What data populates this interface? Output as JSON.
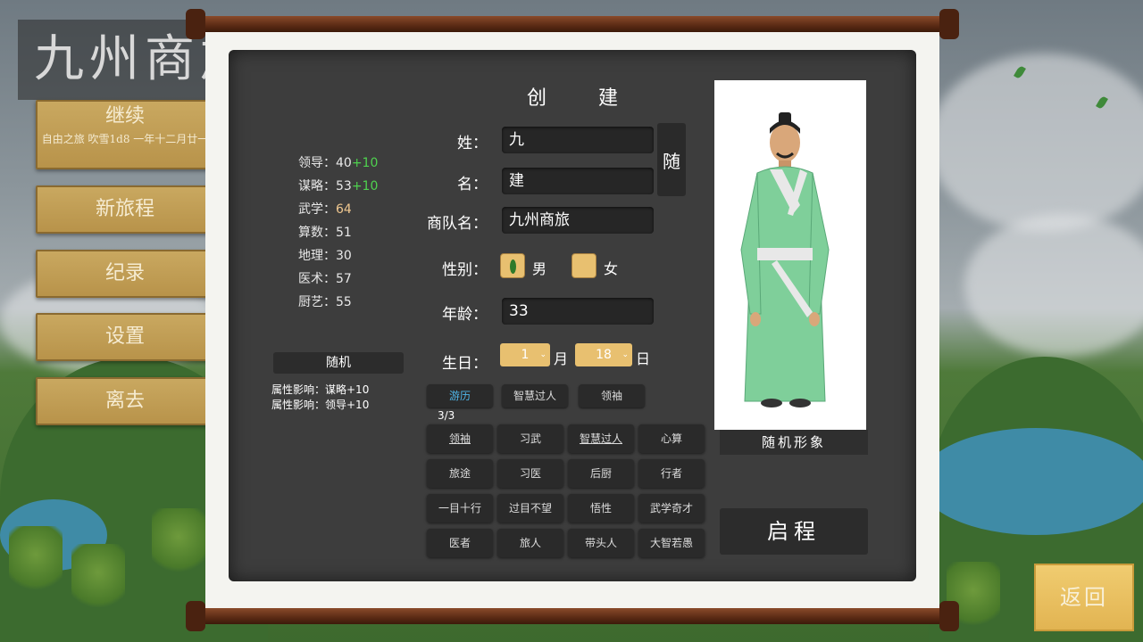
{
  "game_title": "九州商旅",
  "menu": {
    "continue": {
      "label": "继续",
      "save_info": "自由之旅 吹雪1d8 一年十二月廿一"
    },
    "new_journey": "新旅程",
    "records": "纪录",
    "settings": "设置",
    "leave": "离去"
  },
  "create": {
    "title": "创建",
    "stats": [
      {
        "label": "领导",
        "value": "40",
        "bonus": "+10"
      },
      {
        "label": "谋略",
        "value": "53",
        "bonus": "+10"
      },
      {
        "label": "武学",
        "value": "64",
        "bonus": ""
      },
      {
        "label": "算数",
        "value": "51",
        "bonus": ""
      },
      {
        "label": "地理",
        "value": "30",
        "bonus": ""
      },
      {
        "label": "医术",
        "value": "57",
        "bonus": ""
      },
      {
        "label": "厨艺",
        "value": "55",
        "bonus": ""
      }
    ],
    "random_attr_button": "随机",
    "effects": [
      "属性影响：谋略+10",
      "属性影响：领导+10"
    ],
    "surname_label": "姓：",
    "surname_value": "九",
    "given_label": "名：",
    "given_value": "建",
    "random_name_button": "随",
    "caravan_label": "商队名：",
    "caravan_value": "九州商旅",
    "gender_label": "性别：",
    "gender_male": "男",
    "gender_female": "女",
    "gender_selected": "男",
    "age_label": "年龄：",
    "age_value": "33",
    "birthday_label": "生日：",
    "birth_month": "1",
    "month_unit": "月",
    "birth_day": "18",
    "day_unit": "日",
    "selected_traits": [
      {
        "label": "游历",
        "active": true
      },
      {
        "label": "智慧过人",
        "active": false
      },
      {
        "label": "领袖",
        "active": false
      }
    ],
    "trait_count": "3/3",
    "traits": [
      "领袖",
      "习武",
      "智慧过人",
      "心算",
      "旅途",
      "习医",
      "后厨",
      "行者",
      "一目十行",
      "过目不望",
      "悟性",
      "武学奇才",
      "医者",
      "旅人",
      "带头人",
      "大智若愚"
    ],
    "portrait_random_button": "随机形象",
    "start_button": "启程"
  },
  "back_button": "返回",
  "colors": {
    "bonus": "#4fd24f",
    "gold_button": "#e2b452",
    "board": "#3d3d3d",
    "robe": "#7fcf9a",
    "active_tag": "#4fb6e8"
  }
}
